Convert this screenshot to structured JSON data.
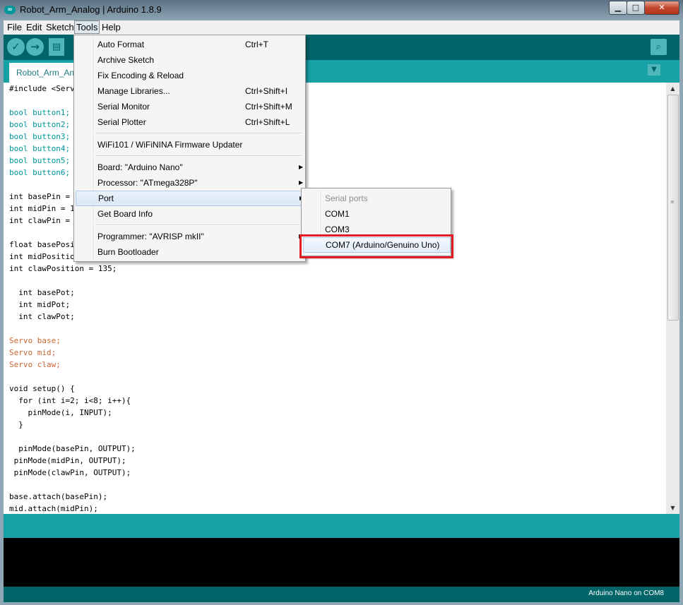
{
  "window": {
    "title": "Robot_Arm_Analog | Arduino 1.8.9",
    "icon": "arduino-logo-icon"
  },
  "menubar": {
    "items": [
      "File",
      "Edit",
      "Sketch",
      "Tools",
      "Help"
    ]
  },
  "toolbar": {
    "verify": "✓",
    "upload": "→",
    "new": "▤",
    "serial": "⌕"
  },
  "tab": {
    "name": "Robot_Arm_Analog",
    "menu_arrow": "▼"
  },
  "code": [
    "#include <Servo.h>",
    "",
    "bool button1;",
    "bool button2;",
    "bool button3;",
    "bool button4;",
    "bool button5;",
    "bool button6;",
    "",
    "int basePin = 9;",
    "int midPin = 10;",
    "int clawPin = 11;",
    "",
    "float basePosition = 90;",
    "int midPosition = 90;",
    "int clawPosition = 135;",
    "",
    "  int basePot;",
    "  int midPot;",
    "  int clawPot;",
    "",
    "Servo base;",
    "Servo mid;",
    "Servo claw;",
    "",
    "void setup() {",
    "  for (int i=2; i<8; i++){",
    "    pinMode(i, INPUT);",
    "  }",
    "",
    "  pinMode(basePin, OUTPUT);",
    " pinMode(midPin, OUTPUT);",
    " pinMode(clawPin, OUTPUT);",
    "",
    "base.attach(basePin);",
    "mid.attach(midPin);"
  ],
  "tools_menu": {
    "items": [
      {
        "label": "Auto Format",
        "shortcut": "Ctrl+T"
      },
      {
        "label": "Archive Sketch",
        "shortcut": ""
      },
      {
        "label": "Fix Encoding & Reload",
        "shortcut": ""
      },
      {
        "label": "Manage Libraries...",
        "shortcut": "Ctrl+Shift+I"
      },
      {
        "label": "Serial Monitor",
        "shortcut": "Ctrl+Shift+M"
      },
      {
        "label": "Serial Plotter",
        "shortcut": "Ctrl+Shift+L"
      },
      {
        "label": "WiFi101 / WiFiNINA Firmware Updater",
        "shortcut": ""
      },
      {
        "label": "Board: \"Arduino Nano\"",
        "shortcut": ""
      },
      {
        "label": "Processor: \"ATmega328P\"",
        "shortcut": ""
      },
      {
        "label": "Port",
        "shortcut": ""
      },
      {
        "label": "Get Board Info",
        "shortcut": ""
      },
      {
        "label": "Programmer: \"AVRISP mkII\"",
        "shortcut": ""
      },
      {
        "label": "Burn Bootloader",
        "shortcut": ""
      }
    ],
    "submenu_arrow": "▶"
  },
  "port_menu": {
    "header": "Serial ports",
    "items": [
      "COM1",
      "COM3",
      "COM7 (Arduino/Genuino Uno)"
    ],
    "highlight_color": "#e21b24"
  },
  "footer": {
    "status": "Arduino Nano on COM8"
  },
  "colors": {
    "teal": "#17a1a5",
    "dark_teal": "#006468",
    "keyword": "#00979c",
    "function": "#d35400"
  }
}
